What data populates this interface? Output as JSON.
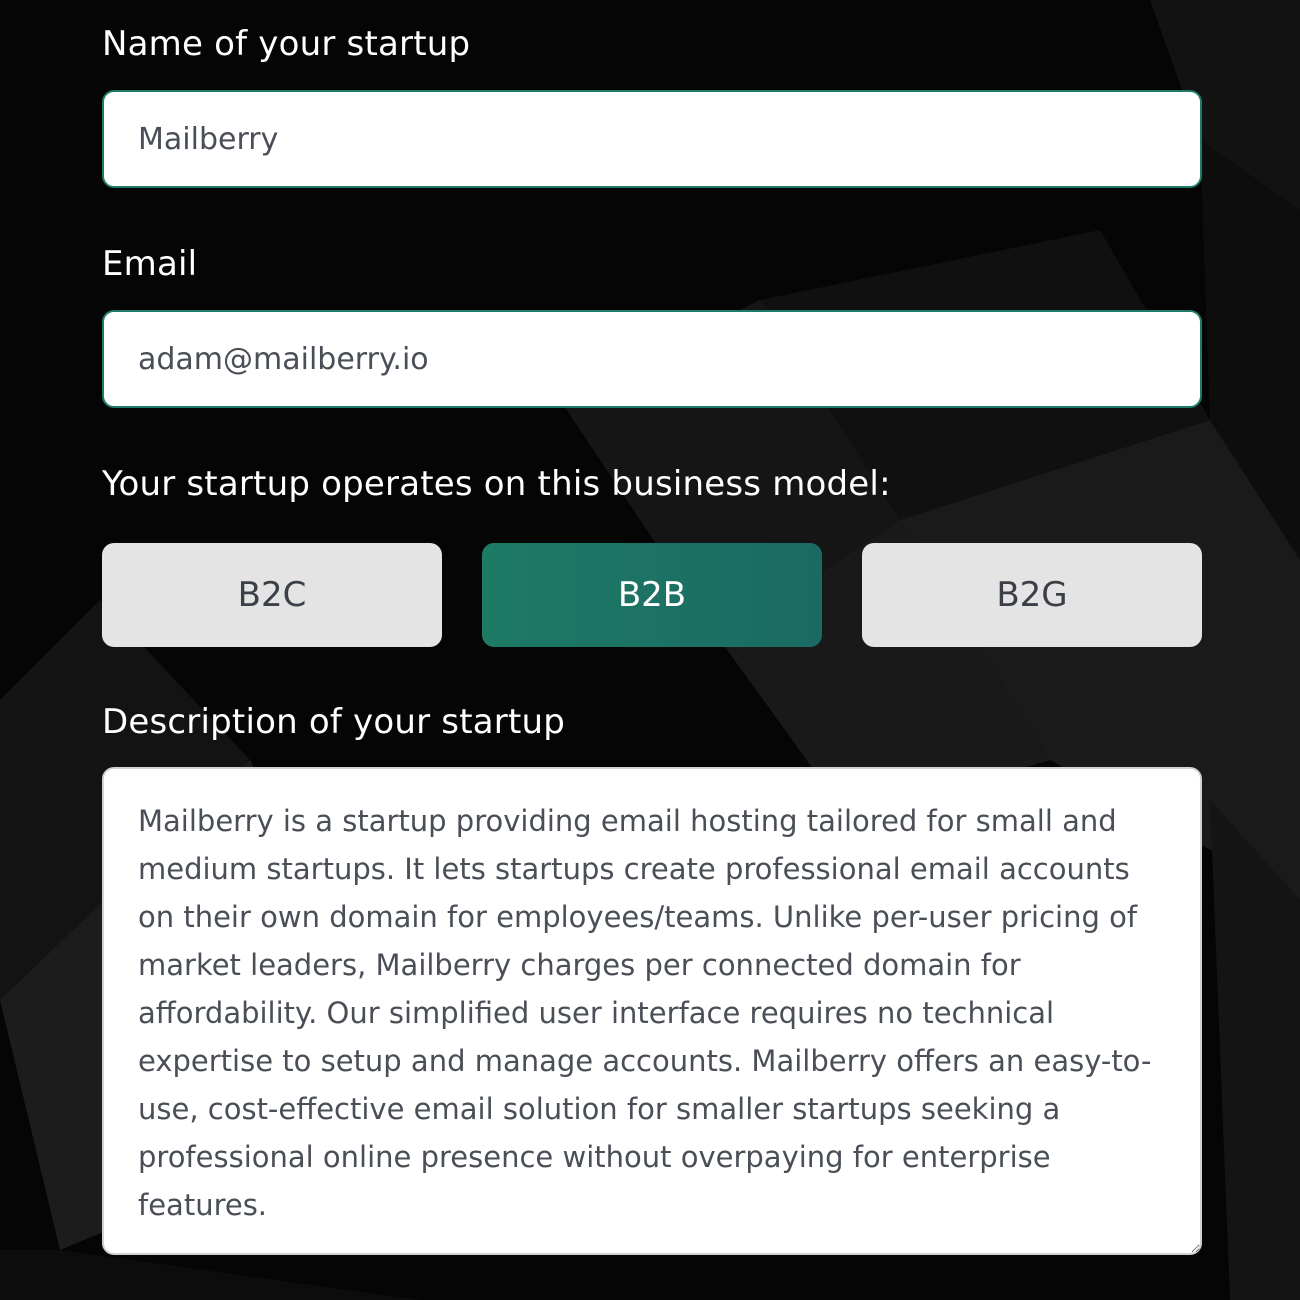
{
  "form": {
    "startup_name": {
      "label": "Name of your startup",
      "value": "Mailberry"
    },
    "email": {
      "label": "Email",
      "value": "adam@mailberry.io"
    },
    "business_model": {
      "label": "Your startup operates on this business model:",
      "options": [
        "B2C",
        "B2B",
        "B2G"
      ],
      "selected": "B2B"
    },
    "description": {
      "label": "Description of your startup",
      "value": "Mailberry is a startup providing email hosting tailored for small and medium startups. It lets startups create professional email accounts on their own domain for employees/teams. Unlike per-user pricing of market leaders, Mailberry charges per connected domain for affordability. Our simplified user interface requires no technical expertise to setup and manage accounts. Mailberry offers an easy-to-use, cost-effective email solution for smaller startups seeking a professional online presence without overpaying for enterprise features."
    }
  },
  "colors": {
    "background": "#050505",
    "accent": "#1d7a64",
    "input_border": "#1f7a68",
    "inactive_option": "#e4e4e4"
  }
}
